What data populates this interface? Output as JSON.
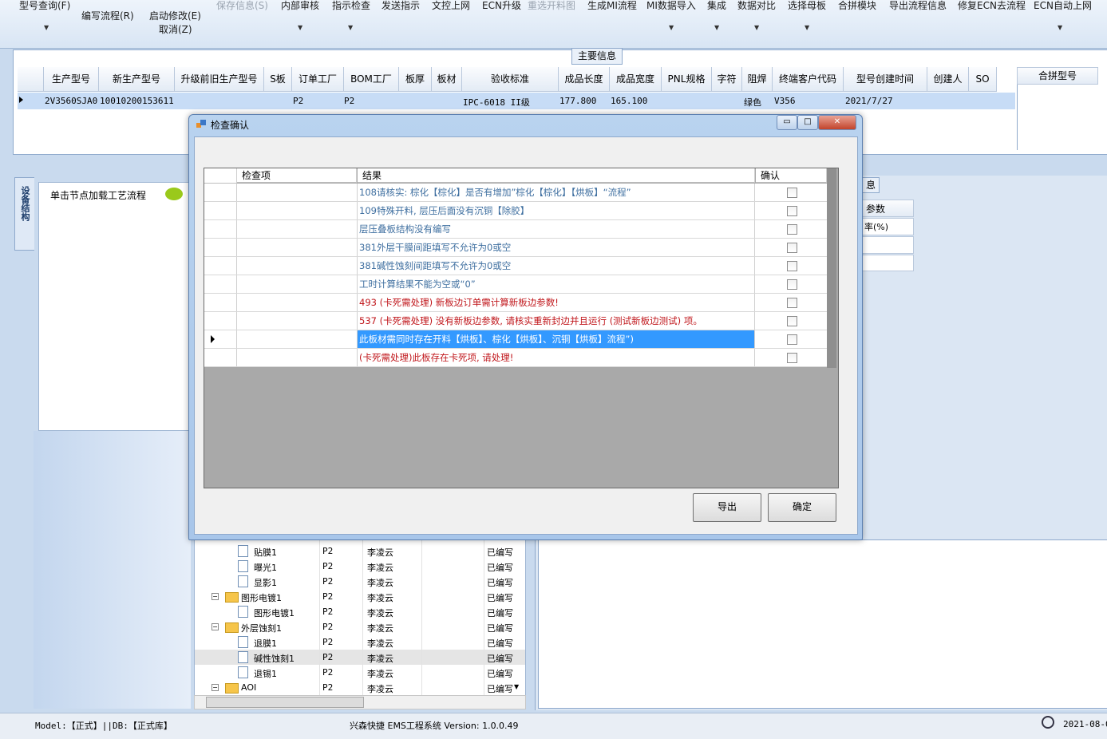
{
  "toolbar": {
    "items": [
      {
        "label": "型号查询(F)",
        "dim": false
      },
      {
        "label": "编写流程(R)",
        "dim": false
      },
      {
        "label": "启动修改(E)",
        "dim": false
      },
      {
        "label": "取消(Z)",
        "dim": false
      },
      {
        "label": "保存信息(S)",
        "dim": true
      },
      {
        "label": "内部审核",
        "dim": false
      },
      {
        "label": "指示检查",
        "dim": false
      },
      {
        "label": "发送指示",
        "dim": false
      },
      {
        "label": "文控上网",
        "dim": false
      },
      {
        "label": "ECN升级",
        "dim": false
      },
      {
        "label": "重选开料图",
        "dim": true
      },
      {
        "label": "生成MI流程",
        "dim": false
      },
      {
        "label": "MI数据导入",
        "dim": false
      },
      {
        "label": "集成",
        "dim": false
      },
      {
        "label": "数据对比",
        "dim": false
      },
      {
        "label": "选择母板",
        "dim": false
      },
      {
        "label": "合拼模块",
        "dim": false
      },
      {
        "label": "导出流程信息",
        "dim": false
      },
      {
        "label": "修复ECN去流程",
        "dim": false
      },
      {
        "label": "ECN自动上网",
        "dim": false
      }
    ]
  },
  "main": {
    "tab_label": "主要信息",
    "columns": [
      "生产型号",
      "新生产型号",
      "升级前旧生产型号",
      "S板",
      "订单工厂",
      "BOM工厂",
      "板厚",
      "板材",
      "验收标准",
      "成品长度",
      "成品宽度",
      "PNL规格",
      "字符",
      "阻焊",
      "终端客户代码",
      "型号创建时间",
      "创建人",
      "SO"
    ],
    "row": [
      "2V3560SJA0",
      "10010200153611",
      "",
      "",
      "P2",
      "P2",
      "",
      "",
      "IPC-6018 II级",
      "177.800",
      "165.100",
      "",
      "",
      "绿色",
      "V356",
      "2021/7/27",
      "",
      ""
    ],
    "merge_header": "合拼型号"
  },
  "left": {
    "tab_label": "设备结构",
    "process_label": "单击节点加载工艺流程"
  },
  "right": {
    "tab_fragment": "息",
    "header_fragment": "参数",
    "cell_fragment": "率(%)"
  },
  "tree": {
    "rows": [
      {
        "name": "贴膜1",
        "factory": "P2",
        "user": "李凌云",
        "status": "已编写",
        "type": "doc"
      },
      {
        "name": "曝光1",
        "factory": "P2",
        "user": "李凌云",
        "status": "已编写",
        "type": "doc"
      },
      {
        "name": "显影1",
        "factory": "P2",
        "user": "李凌云",
        "status": "已编写",
        "type": "doc"
      },
      {
        "name": "图形电镀1",
        "factory": "P2",
        "user": "李凌云",
        "status": "已编写",
        "type": "folder"
      },
      {
        "name": "图形电镀1",
        "factory": "P2",
        "user": "李凌云",
        "status": "已编写",
        "type": "doc"
      },
      {
        "name": "外层蚀刻1",
        "factory": "P2",
        "user": "李凌云",
        "status": "已编写",
        "type": "folder"
      },
      {
        "name": "退膜1",
        "factory": "P2",
        "user": "李凌云",
        "status": "已编写",
        "type": "doc"
      },
      {
        "name": "碱性蚀刻1",
        "factory": "P2",
        "user": "李凌云",
        "status": "已编写",
        "type": "doc",
        "selected": true
      },
      {
        "name": "退锡1",
        "factory": "P2",
        "user": "李凌云",
        "status": "已编写",
        "type": "doc"
      },
      {
        "name": "AOI",
        "factory": "P2",
        "user": "李凌云",
        "status": "已编写",
        "type": "folder"
      }
    ]
  },
  "status": {
    "left": "Model:【正式】||DB:【正式库】",
    "center": "兴森快捷 EMS工程系统 Version: 1.0.0.49",
    "right": "2021-08-0"
  },
  "dialog": {
    "title": "检查确认",
    "columns": {
      "check_item": "检查项",
      "result": "结果",
      "confirm": "确认"
    },
    "rows": [
      {
        "result": "108请核实: 棕化【棕化】是否有增加”棕化【棕化】【烘板】“流程”",
        "color": "blue"
      },
      {
        "result": "109特殊开料, 层压后面没有沉铜【除胶】",
        "color": "blue"
      },
      {
        "result": "层压叠板结构没有编写",
        "color": "blue"
      },
      {
        "result": "381外层干膜间距填写不允许为0或空",
        "color": "blue"
      },
      {
        "result": "381碱性蚀刻间距填写不允许为0或空",
        "color": "blue"
      },
      {
        "result": "工时计算结果不能为空或“0”",
        "color": "blue"
      },
      {
        "result": "493 (卡死需处理) 新板边订单需计算新板边参数!",
        "color": "red"
      },
      {
        "result": "537 (卡死需处理) 没有新板边参数, 请核实重新封边并且运行 (测试新板边测试) 项。",
        "color": "red"
      },
      {
        "result": "此板材需同时存在开料【烘板】、棕化【烘板】、沉铜【烘板】流程”)",
        "color": "sel"
      },
      {
        "result": "(卡死需处理)此板存在卡死项, 请处理!",
        "color": "red"
      }
    ],
    "export_label": "导出",
    "ok_label": "确定"
  }
}
